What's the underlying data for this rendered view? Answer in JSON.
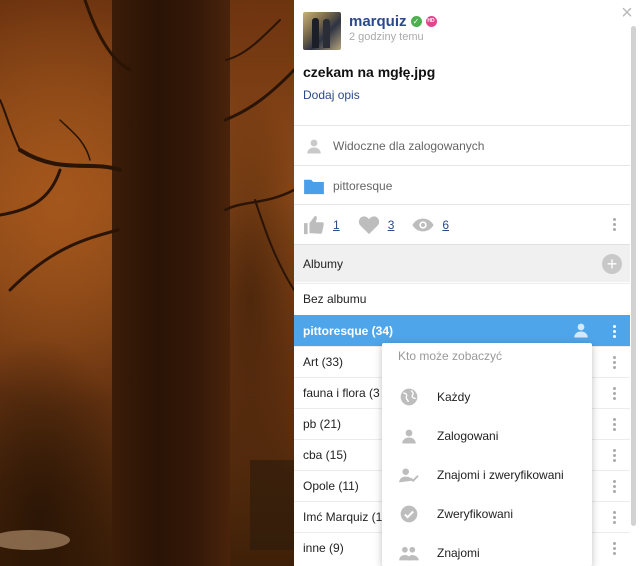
{
  "author": {
    "name": "marquiz",
    "verified_icon": "check-circle-icon",
    "badge_text": "HD",
    "time": "2 godziny temu"
  },
  "photo": {
    "title": "czekam na mgłę.jpg",
    "add_description": "Dodaj opis"
  },
  "visibility": {
    "icon": "person-icon",
    "label": "Widoczne dla zalogowanych"
  },
  "album": {
    "icon": "folder-icon",
    "label": "pittoresque"
  },
  "stats": {
    "likes": "1",
    "hearts": "3",
    "views": "6"
  },
  "albums": {
    "header": "Albumy",
    "add_icon": "plus-icon",
    "items": [
      {
        "label": "Bez albumu"
      },
      {
        "label": "pittoresque (34)"
      },
      {
        "label": "Art (33)"
      },
      {
        "label": "fauna i flora (3"
      },
      {
        "label": "pb (21)"
      },
      {
        "label": "cba (15)"
      },
      {
        "label": "Opole (11)"
      },
      {
        "label": "Imć Marquiz (1"
      },
      {
        "label": "inne (9)"
      }
    ]
  },
  "privacy_menu": {
    "title": "Kto może zobaczyć",
    "items": [
      {
        "label": "Każdy",
        "icon": "globe-icon"
      },
      {
        "label": "Zalogowani",
        "icon": "person-icon"
      },
      {
        "label": "Znajomi i zweryfikowani",
        "icon": "person-check-icon"
      },
      {
        "label": "Zweryfikowani",
        "icon": "check-circle-icon"
      },
      {
        "label": "Znajomi",
        "icon": "people-icon"
      }
    ]
  },
  "colors": {
    "accent": "#4fa5ea",
    "link": "#2b4a8b",
    "folder": "#4a9fe8",
    "verified": "#4caf50",
    "badge": "#e0468c"
  }
}
